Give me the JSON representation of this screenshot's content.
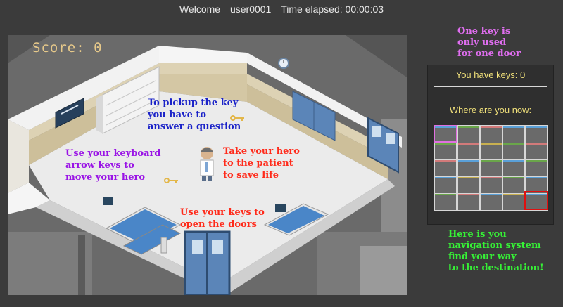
{
  "header": {
    "welcome": "Welcome",
    "username": "user0001",
    "time_label": "Time elapsed: 00:00:03"
  },
  "game": {
    "score_label": "Score: 0",
    "hints": {
      "pickup": "To pickup the key\nyou have to\nanswer a question",
      "keyboard": "Use your keyboard\narrow keys to\nmove your hero",
      "patient": "Take your hero\nto the patient\nto save life",
      "doors": "Use your keys to\nopen the doors"
    }
  },
  "side": {
    "one_key": "One key is\nonly used\nfor one door",
    "keys_label": "You have keys: 0",
    "where_label": "Where are you now:",
    "navigation": "Here is you\nnavigation system\nfind your way\nto the destination!"
  },
  "colors": {
    "hint_blue": "#1a22c8",
    "hint_purple": "#9a14e6",
    "hint_red": "#ff2a1a",
    "note_magenta": "#e06ef0",
    "note_green": "#36f236",
    "keys_yellow": "#f0e07a",
    "current_room": "#e070e0",
    "destination_room": "#e01010"
  },
  "icons": [
    "key-icon",
    "hero-doctor-icon",
    "hospital-bed-icon",
    "door-icon",
    "clock-icon"
  ]
}
